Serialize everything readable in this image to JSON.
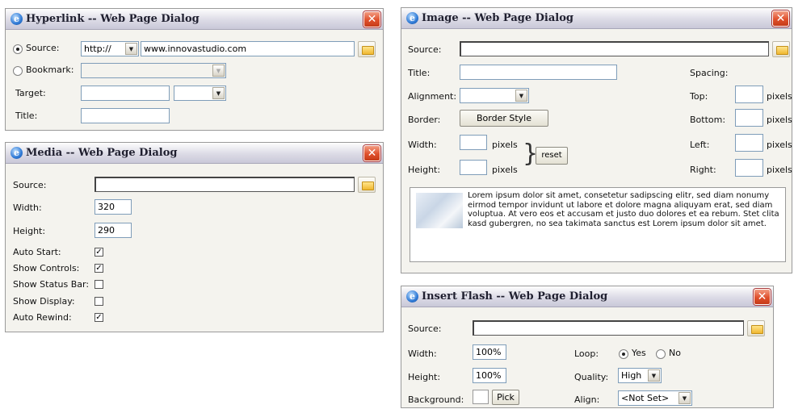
{
  "hyperlink": {
    "title": "Hyperlink -- Web Page Dialog",
    "source_label": "Source:",
    "source_protocol": "http://",
    "source_value": "www.innovastudio.com",
    "bookmark_label": "Bookmark:",
    "target_label": "Target:",
    "title_label": "Title:"
  },
  "media": {
    "title": "Media -- Web Page Dialog",
    "source_label": "Source:",
    "width_label": "Width:",
    "width_value": "320",
    "height_label": "Height:",
    "height_value": "290",
    "options": [
      {
        "label": "Auto Start:",
        "checked": true
      },
      {
        "label": "Show Controls:",
        "checked": true
      },
      {
        "label": "Show Status Bar:",
        "checked": false
      },
      {
        "label": "Show Display:",
        "checked": false
      },
      {
        "label": "Auto Rewind:",
        "checked": true
      }
    ]
  },
  "image": {
    "title": "Image -- Web Page Dialog",
    "source_label": "Source:",
    "title_label": "Title:",
    "alignment_label": "Alignment:",
    "border_label": "Border:",
    "border_style_button": "Border Style",
    "width_label": "Width:",
    "height_label": "Height:",
    "pixels": "pixels",
    "reset_button": "reset",
    "spacing_label": "Spacing:",
    "top_label": "Top:",
    "bottom_label": "Bottom:",
    "left_label": "Left:",
    "right_label": "Right:",
    "preview_text": "Lorem ipsum dolor sit amet, consetetur sadipscing elitr, sed diam nonumy eirmod tempor invidunt ut labore et dolore magna aliquyam erat, sed diam voluptua. At vero eos et accusam et justo duo dolores et ea rebum. Stet clita kasd gubergren, no sea takimata sanctus est Lorem ipsum dolor sit amet."
  },
  "flash": {
    "title": "Insert Flash -- Web Page Dialog",
    "source_label": "Source:",
    "width_label": "Width:",
    "width_value": "100%",
    "height_label": "Height:",
    "height_value": "100%",
    "background_label": "Background:",
    "pick_button": "Pick",
    "loop_label": "Loop:",
    "loop_yes": "Yes",
    "loop_no": "No",
    "quality_label": "Quality:",
    "quality_value": "High",
    "align_label": "Align:",
    "align_value": "<Not Set>"
  },
  "icons": [
    "ie-page-icon",
    "close-icon",
    "folder-icon",
    "dropdown-arrow-icon",
    "checkbox-checked-icon"
  ],
  "colors": {
    "dialog_bg": "#f4f3ee",
    "close_red": "#e0502c",
    "input_border": "#7f9db9"
  }
}
